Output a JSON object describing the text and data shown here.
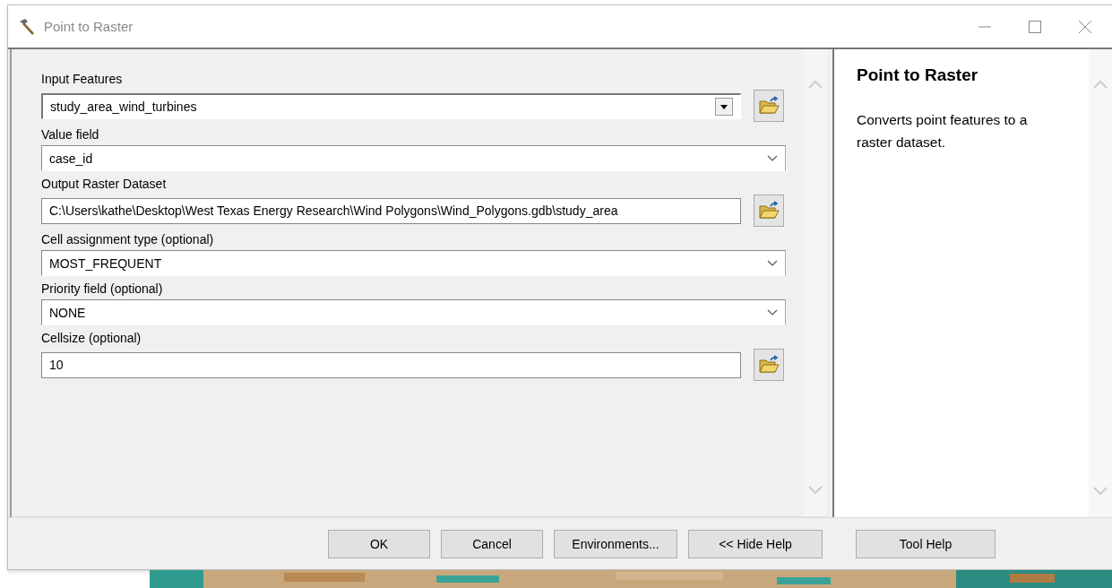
{
  "window": {
    "title": "Point to Raster"
  },
  "parameters": [
    {
      "label": "Input Features",
      "value": "study_area_wind_turbines",
      "kind": "combo_browse"
    },
    {
      "label": "Value field",
      "value": "case_id",
      "kind": "dropdown"
    },
    {
      "label": "Output Raster Dataset",
      "value": "C:\\Users\\kathe\\Desktop\\West Texas Energy Research\\Wind Polygons\\Wind_Polygons.gdb\\study_area",
      "kind": "text_browse"
    },
    {
      "label": "Cell assignment type (optional)",
      "value": "MOST_FREQUENT",
      "kind": "dropdown"
    },
    {
      "label": "Priority field (optional)",
      "value": "NONE",
      "kind": "dropdown"
    },
    {
      "label": "Cellsize (optional)",
      "value": "10",
      "kind": "text_browse"
    }
  ],
  "help": {
    "title": "Point to Raster",
    "text": "Converts point features to a raster dataset."
  },
  "buttons": [
    "OK",
    "Cancel",
    "Environments...",
    "<< Hide Help",
    "Tool Help"
  ]
}
